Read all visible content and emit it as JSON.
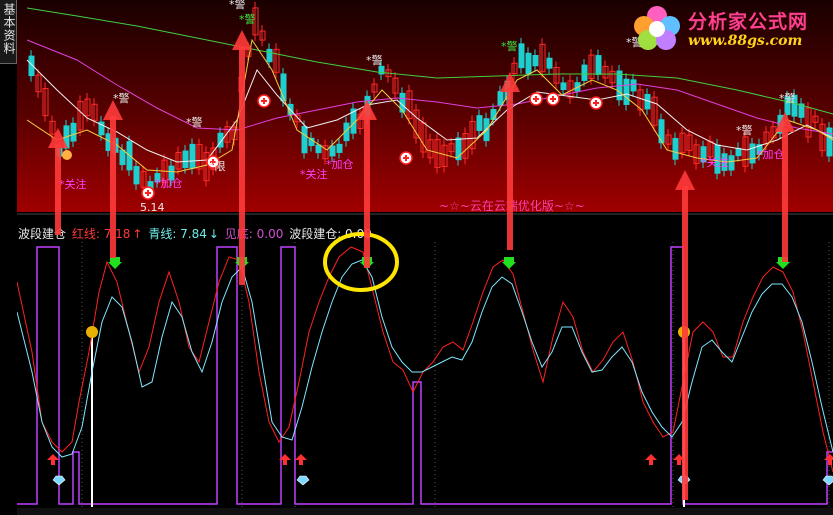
{
  "side_tab": {
    "label": "基本资料"
  },
  "watermark": {
    "title": "分析家公式网",
    "url": "www.88gs.com"
  },
  "banner_text": "~☆~云在云端优化版~☆~",
  "legend": {
    "title": "波段建仓",
    "red_label": "红线: 7.18",
    "red_arrow": "↑",
    "cyan_label": "青线: 7.84",
    "cyan_arrow": "↓",
    "bottom_label": "见底: 0.00",
    "build_label": "波段建仓: 0.00"
  },
  "marks": {
    "warn": "*警",
    "focus": "*关注",
    "add": "*加仓",
    "limit": "*限",
    "price": "5.14"
  },
  "colors": {
    "top_bg": "#4a0000",
    "red_line": "#ff2020",
    "cyan_line": "#7fe8ff",
    "purple_line": "#c040ff",
    "highlight_circle": "#ffe600"
  }
}
